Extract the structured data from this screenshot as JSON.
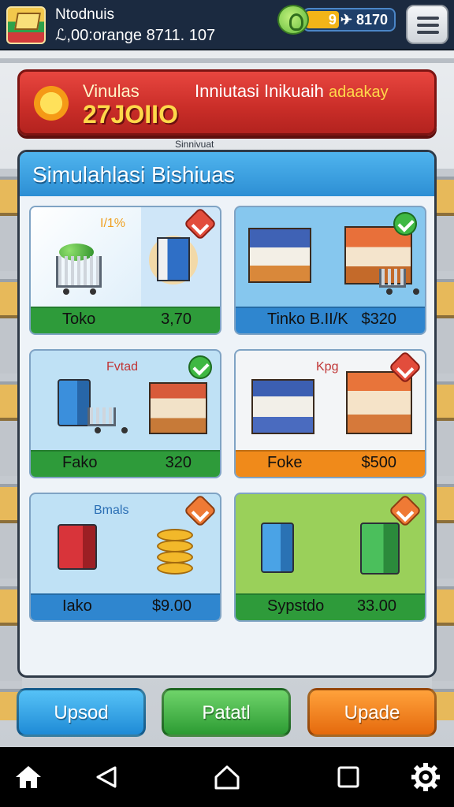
{
  "topbar": {
    "player_name": "Ntodnuis",
    "player_stats": "ℒ,00:orange 8711. 107",
    "currency": {
      "value": "9  ✈ 8170",
      "fill_fraction": 0.38,
      "accent_color": "#f2b418"
    },
    "icons": {
      "gem": "gem-icon",
      "menu": "hamburger-menu-icon"
    }
  },
  "banner": {
    "label": "Vinulas",
    "value": "27JOIIO",
    "subtitle": "Inniutasi Inikuaih",
    "subtitle_accent": "adaakay",
    "color": "#c92d28"
  },
  "section_tag": "Sinnivuat",
  "panel": {
    "title": "Simulahlasi Bishiuas",
    "header_color": "#2d8fd4",
    "cards": [
      {
        "name": "Toko",
        "price": "3,70",
        "caption": "I/1%",
        "badge": "lock",
        "footer_color": "#2e9b3a",
        "bg": "#cfe6f8"
      },
      {
        "name": "Tinko  B.II/K",
        "price": "$320",
        "caption": "",
        "badge": "check",
        "footer_color": "#2f86cf",
        "bg": "#86c7ee"
      },
      {
        "name": "Fako",
        "price": "320",
        "caption": "Fvtad",
        "badge": "check",
        "footer_color": "#2e9b3a",
        "bg": "#bfe1f5"
      },
      {
        "name": "Foke",
        "price": "$500",
        "caption": "Kpg",
        "badge": "lock",
        "footer_color": "#f08a1a",
        "bg": "#f3f5f7"
      },
      {
        "name": "Iako",
        "price": "$9.00",
        "caption": "Bmals",
        "badge": "orange",
        "footer_color": "#2f86cf",
        "bg": "#bfe1f5"
      },
      {
        "name": "Sypstdo",
        "price": "33.00",
        "caption": "",
        "badge": "orange",
        "footer_color": "#2e9b3a",
        "bg": "#9ad05a"
      }
    ]
  },
  "buttons": {
    "blue_label": "Upsod",
    "green_label": "Patatl",
    "orange_label": "Upade"
  },
  "navbar": {
    "icons": [
      "home-icon",
      "back-icon",
      "launcher-icon",
      "recents-icon",
      "settings-gear-icon"
    ]
  }
}
